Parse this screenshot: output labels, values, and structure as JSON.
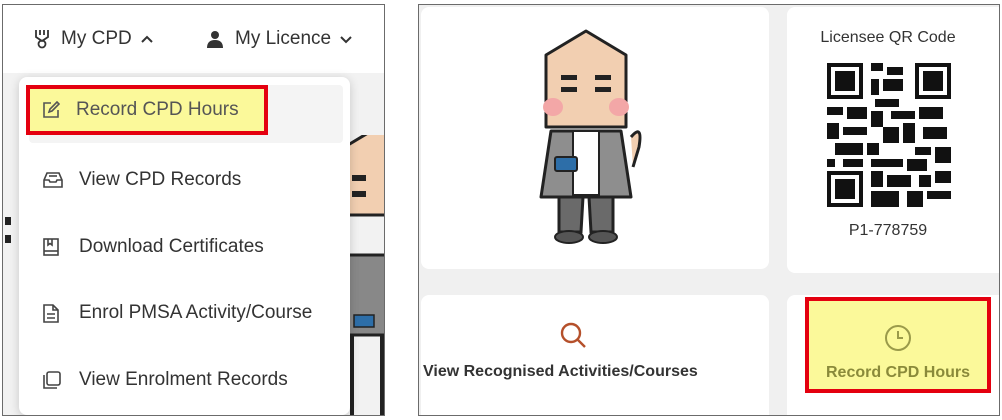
{
  "left_panel": {
    "nav": {
      "my_cpd": {
        "label": "My CPD",
        "icon": "medal-icon",
        "chevron": "chevron-up-icon"
      },
      "my_licence": {
        "label": "My Licence",
        "icon": "user-icon",
        "chevron": "chevron-down-icon"
      }
    },
    "dropdown": {
      "items": [
        {
          "label": "Record CPD Hours",
          "icon": "edit-square-icon",
          "highlighted": true
        },
        {
          "label": "View CPD Records",
          "icon": "inbox-icon"
        },
        {
          "label": "Download Certificates",
          "icon": "certificate-book-icon"
        },
        {
          "label": "Enrol PMSA Activity/Course",
          "icon": "document-icon"
        },
        {
          "label": "View Enrolment Records",
          "icon": "copy-icon"
        }
      ]
    }
  },
  "right_panel": {
    "qr_card": {
      "title": "Licensee QR Code",
      "licence_id": "P1-778759"
    },
    "activities_card": {
      "label": "View Recognised Activities/Courses",
      "icon": "search-icon",
      "icon_color": "#b5502b"
    },
    "record_card": {
      "label": "Record CPD Hours",
      "icon": "clock-icon",
      "highlighted": true
    }
  },
  "colors": {
    "highlight_fill": "#fbf99a",
    "highlight_border": "#e4000f",
    "panel_bg": "#f0f0f0"
  }
}
